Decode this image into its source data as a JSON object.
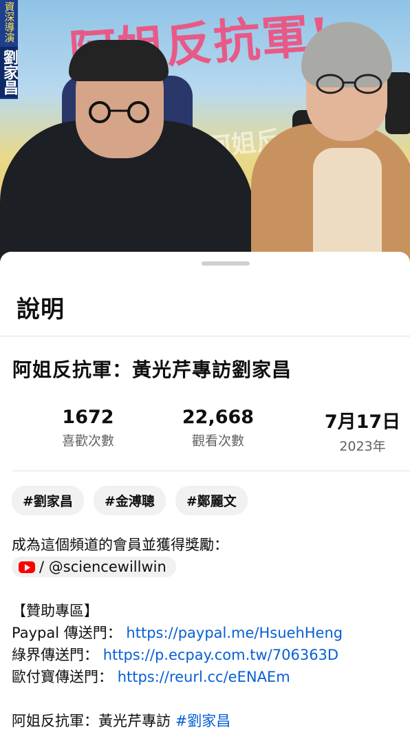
{
  "video": {
    "banner_text": "阿姐反抗軍!",
    "banner_text_small": "阿姐反",
    "side_tag_role": "資深導演",
    "side_tag_name": "劉家昌"
  },
  "sheet": {
    "title": "說明"
  },
  "video_title": "阿姐反抗軍：黃光芹專訪劉家昌",
  "stats": {
    "likes": {
      "value": "1672",
      "label": "喜歡次數"
    },
    "views": {
      "value": "22,668",
      "label": "觀看次數"
    },
    "date": {
      "value": "7月17日",
      "label": "2023年"
    }
  },
  "hashtags": [
    "#劉家昌",
    "#金溥聰",
    "#鄭麗文"
  ],
  "description": {
    "member_line": "成為這個頻道的會員並獲得獎勵：",
    "handle": "/ @sciencewillwin",
    "sponsor_header": "【贊助專區】",
    "paypal_label": "Paypal 傳送門：",
    "paypal_link": "https://paypal.me/HsuehHeng",
    "ecpay_label": "綠界傳送門：",
    "ecpay_link": "https://p.ecpay.com.tw/706363D",
    "opay_label": "歐付寶傳送門：",
    "opay_link": "https://reurl.cc/eENAEm",
    "last_line_text": "阿姐反抗軍：黃光芹專訪 ",
    "last_line_tag": "#劉家昌"
  },
  "colors": {
    "link": "#065fd4",
    "youtube_red": "#ff0000",
    "chip_bg": "#f1f1f1"
  }
}
